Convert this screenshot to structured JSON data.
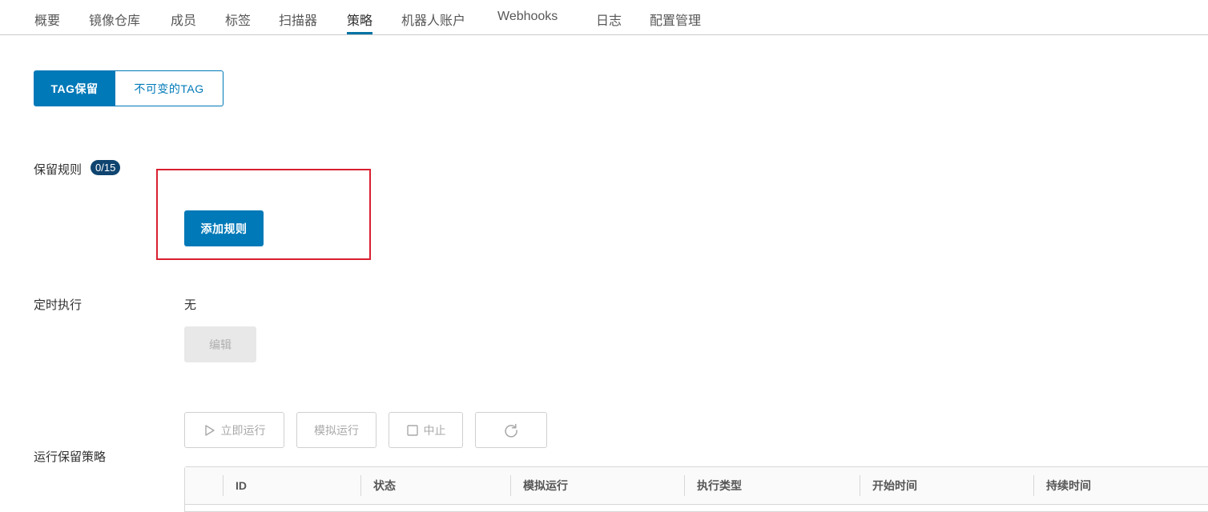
{
  "tabs": [
    {
      "label": "概要"
    },
    {
      "label": "镜像仓库"
    },
    {
      "label": "成员"
    },
    {
      "label": "标签"
    },
    {
      "label": "扫描器"
    },
    {
      "label": "策略",
      "active": true
    },
    {
      "label": "机器人账户"
    },
    {
      "label": "Webhooks"
    },
    {
      "label": "日志"
    },
    {
      "label": "配置管理"
    }
  ],
  "segment": {
    "tag_retention": "TAG保留",
    "immutable_tag": "不可变的TAG"
  },
  "retention_rules": {
    "label": "保留规则",
    "count": "0/15",
    "add_button": "添加规则"
  },
  "schedule": {
    "label": "定时执行",
    "value": "无",
    "edit_button": "编辑"
  },
  "run": {
    "label": "运行保留策略",
    "run_now": "立即运行",
    "dry_run": "模拟运行",
    "abort": "中止"
  },
  "table": {
    "columns": [
      "ID",
      "状态",
      "模拟运行",
      "执行类型",
      "开始时间",
      "持续时间"
    ]
  },
  "colors": {
    "accent": "#0079b8",
    "badge": "#0f4470",
    "highlight": "#d92030"
  }
}
